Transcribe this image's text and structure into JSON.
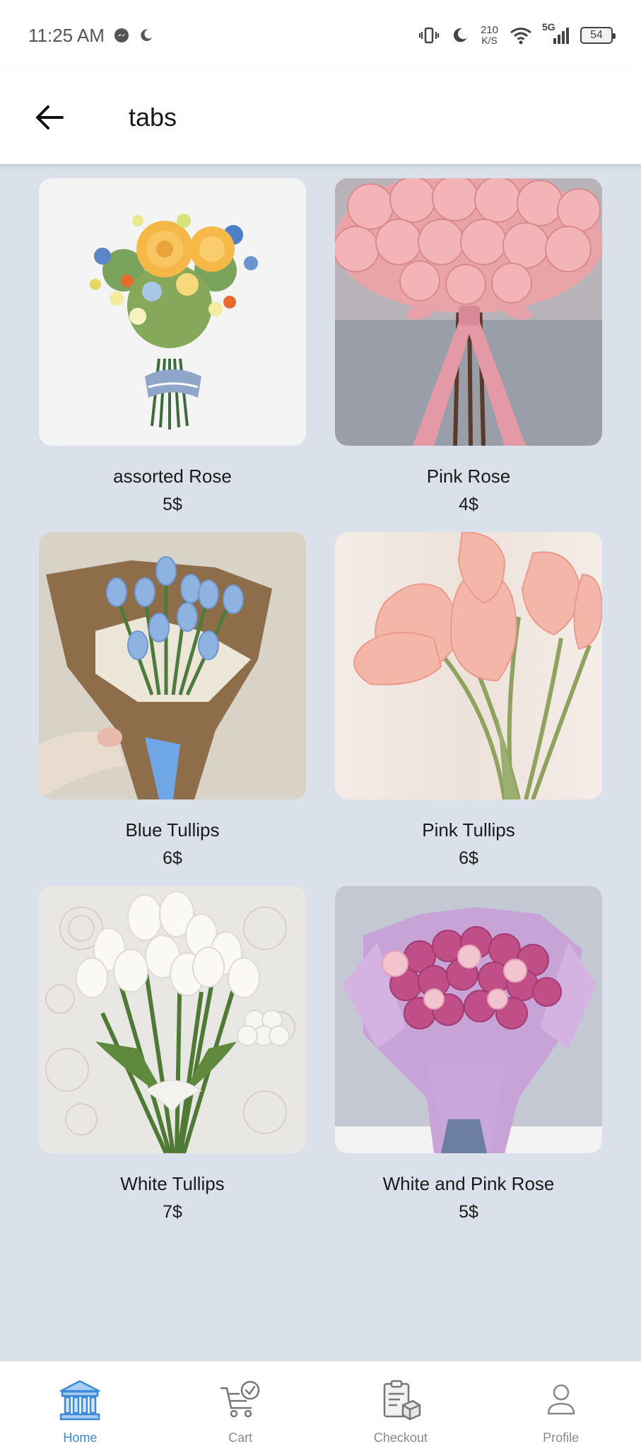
{
  "status_bar": {
    "time": "11:25 AM",
    "net_speed_value": "210",
    "net_speed_unit": "K/S",
    "network": "5G",
    "battery": "54"
  },
  "app_bar": {
    "title": "tabs",
    "back_icon": "arrow-left-icon"
  },
  "products": [
    {
      "name": "assorted Rose",
      "price": "5$",
      "image": "assorted-bouquet"
    },
    {
      "name": "Pink Rose",
      "price": "4$",
      "image": "pink-rose-bouquet"
    },
    {
      "name": "Blue Tullips",
      "price": "6$",
      "image": "blue-tulip-bouquet"
    },
    {
      "name": "Pink Tullips",
      "price": "6$",
      "image": "pink-tulips-vase"
    },
    {
      "name": "White Tullips",
      "price": "7$",
      "image": "white-tulip-bouquet"
    },
    {
      "name": "White and Pink Rose",
      "price": "5$",
      "image": "white-pink-rose-bouquet"
    }
  ],
  "bottom_nav": {
    "items": [
      {
        "label": "Home",
        "icon": "bank-icon",
        "active": true
      },
      {
        "label": "Cart",
        "icon": "cart-icon",
        "active": false
      },
      {
        "label": "Checkout",
        "icon": "checkout-icon",
        "active": false
      },
      {
        "label": "Profile",
        "icon": "profile-icon",
        "active": false
      }
    ]
  },
  "colors": {
    "background": "#dbe1ea",
    "active_nav": "#3b8ad8",
    "inactive_nav": "#8a8a8a"
  }
}
